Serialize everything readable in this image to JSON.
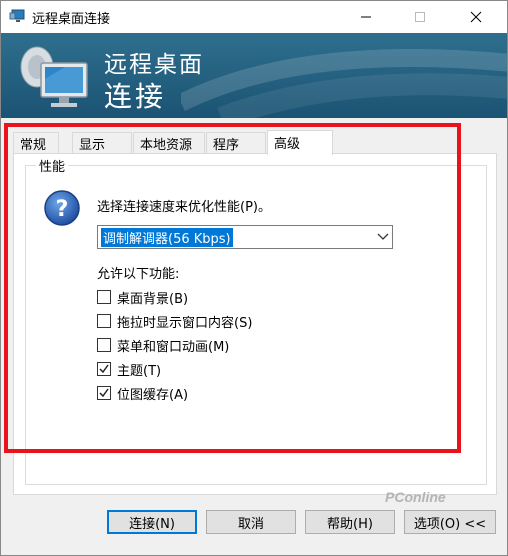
{
  "window": {
    "title": "远程桌面连接",
    "banner_line1": "远程桌面",
    "banner_line2": "连接"
  },
  "tabs": [
    {
      "label": "常规",
      "selected": false
    },
    {
      "label": "显示",
      "selected": false
    },
    {
      "label": "本地资源",
      "selected": false
    },
    {
      "label": "程序",
      "selected": false
    },
    {
      "label": "高级",
      "selected": true
    }
  ],
  "performance": {
    "group_title": "性能",
    "prompt": "选择连接速度来优化性能(P)。",
    "connection_speed": "调制解调器(56 Kbps)",
    "allow_label": "允许以下功能:",
    "options": [
      {
        "label": "桌面背景(B)",
        "checked": false
      },
      {
        "label": "拖拉时显示窗口内容(S)",
        "checked": false
      },
      {
        "label": "菜单和窗口动画(M)",
        "checked": false
      },
      {
        "label": "主题(T)",
        "checked": true
      },
      {
        "label": "位图缓存(A)",
        "checked": true
      }
    ]
  },
  "buttons": {
    "connect": "连接(N)",
    "cancel": "取消",
    "help": "帮助(H)",
    "options": "选项(O) <<"
  },
  "watermark": "PConline",
  "colors": {
    "banner": "#1b5373",
    "highlight": "#e8131c",
    "accent": "#0078d7"
  }
}
